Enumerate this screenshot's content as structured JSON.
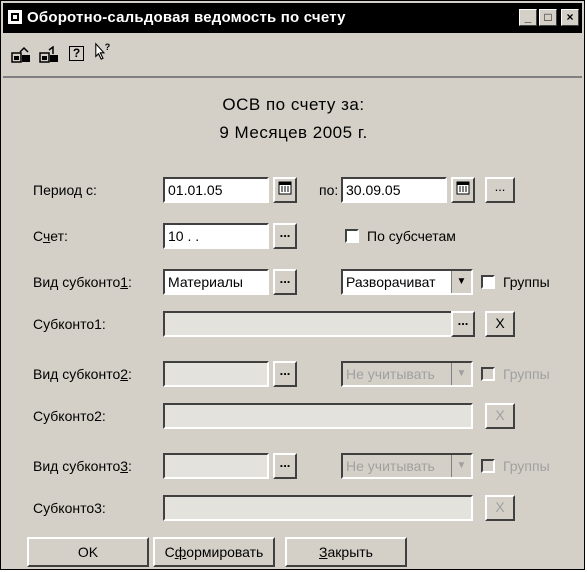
{
  "window": {
    "title": "Оборотно-сальдовая ведомость по счету",
    "minimize": "_",
    "maximize": "□",
    "close": "×"
  },
  "toolbar": {
    "icons": [
      "open-report-icon",
      "save-report-icon",
      "help-icon",
      "context-help-icon"
    ],
    "help_glyph": "?",
    "context_help_glyph": "?"
  },
  "heading": {
    "line1": "ОСВ по счету за:",
    "line2": "9 Месяцев 2005 г."
  },
  "period": {
    "label": "Период с:",
    "from": "01.01.05",
    "to_label": "по:",
    "to": "30.09.05",
    "more": "..."
  },
  "account": {
    "label_pre": "С",
    "label_ul": "ч",
    "label_post": "ет:",
    "value": "10 . .",
    "subaccounts_label": "По субсчетам"
  },
  "sub1": {
    "type_label_pre": "Вид субконто",
    "type_label_ul": "1",
    "type_label_post": ":",
    "type_value": "Материалы",
    "mode": "Разворачиват",
    "groups": "Группы",
    "label": "Субконто1:",
    "value": ""
  },
  "sub2": {
    "type_label_pre": "Вид субконто",
    "type_label_ul": "2",
    "type_label_post": ":",
    "type_value": "",
    "mode": "Не учитывать",
    "groups": "Группы",
    "label": "Субконто2:",
    "value": ""
  },
  "sub3": {
    "type_label_pre": "Вид субконто",
    "type_label_ul": "3",
    "type_label_post": ":",
    "type_value": "",
    "mode": "Не учитывать",
    "groups": "Группы",
    "label": "Субконто3:",
    "value": ""
  },
  "glyphs": {
    "ellipsis": "...",
    "clear": "X",
    "dropdown": "▼"
  },
  "buttons": {
    "ok": "OK",
    "generate_ul": "ф",
    "generate_pre": "С",
    "generate_post": "ормировать",
    "close_ul": "З",
    "close_post": "акрыть"
  }
}
